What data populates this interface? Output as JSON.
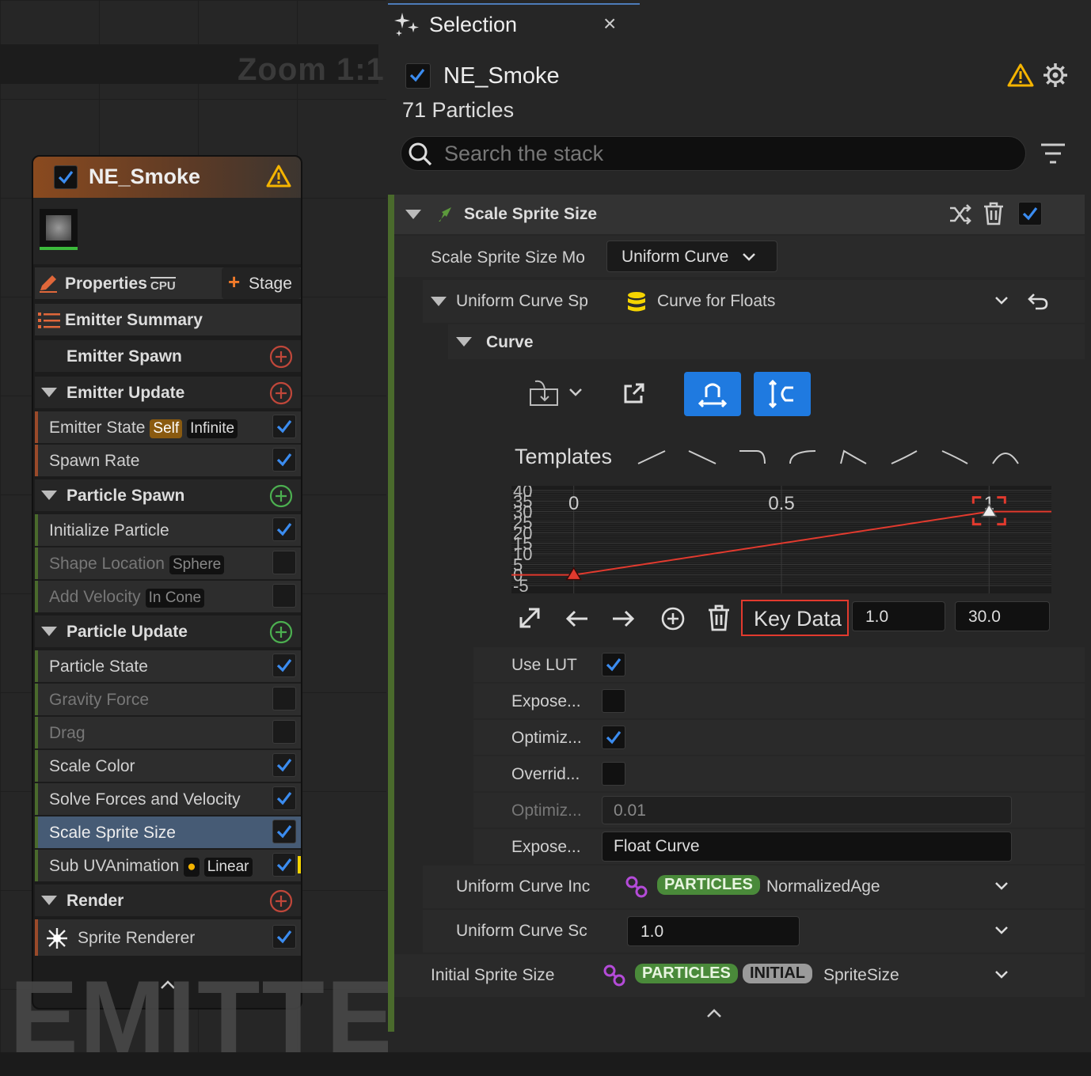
{
  "graph": {
    "zoom_label": "Zoom 1:1",
    "watermark": "EMITTER"
  },
  "node": {
    "title": "NE_Smoke",
    "properties_label": "Properties",
    "cpu_badge": "CPU",
    "stage_label": "Stage",
    "emitter_summary": "Emitter Summary",
    "emitter_spawn": "Emitter Spawn",
    "emitter_update": "Emitter Update",
    "emitter_state": "Emitter State",
    "emitter_state_self": "Self",
    "emitter_state_infinite": "Infinite",
    "spawn_rate": "Spawn Rate",
    "particle_spawn": "Particle Spawn",
    "initialize_particle": "Initialize Particle",
    "shape_location": "Shape Location",
    "shape_location_tag": "Sphere",
    "add_velocity": "Add Velocity",
    "add_velocity_tag": "In Cone",
    "particle_update": "Particle Update",
    "particle_state": "Particle State",
    "gravity_force": "Gravity Force",
    "drag": "Drag",
    "scale_color": "Scale Color",
    "solve_forces": "Solve Forces and Velocity",
    "scale_sprite_size": "Scale Sprite Size",
    "sub_uv": "Sub UVAnimation",
    "sub_uv_tag": "Linear",
    "render": "Render",
    "sprite_renderer": "Sprite Renderer"
  },
  "panel": {
    "tab_title": "Selection",
    "tab_close": "×",
    "emitter_name": "NE_Smoke",
    "particle_count": "71 Particles",
    "search_placeholder": "Search the stack",
    "section_title": "Scale Sprite Size",
    "mode_label": "Scale Sprite Size Mo",
    "mode_value": "Uniform Curve",
    "uniform_curve_label": "Uniform Curve Sp",
    "uniform_curve_value": "Curve for Floats",
    "curve_label": "Curve",
    "templates_label": "Templates",
    "key_data_label": "Key Data",
    "key_time": "1.0",
    "key_value": "30.0",
    "use_lut": "Use LUT",
    "expose1": "Expose...",
    "optimize1": "Optimiz...",
    "override": "Overrid...",
    "optimize2": "Optimiz...",
    "optimize2_value": "0.01",
    "expose2": "Expose...",
    "expose2_value": "Float Curve",
    "curve_index_label": "Uniform Curve Inc",
    "curve_index_tag": "PARTICLES",
    "curve_index_value": "NormalizedAge",
    "curve_scale_label": "Uniform Curve Sc",
    "curve_scale_value": "1.0",
    "initial_size_label": "Initial Sprite Size",
    "initial_tag1": "PARTICLES",
    "initial_tag2": "INITIAL",
    "initial_value": "SpriteSize"
  },
  "chart_data": {
    "type": "line",
    "x_ticks": [
      "0",
      "0.5",
      "1"
    ],
    "y_ticks": [
      "40",
      "35",
      "30",
      "25",
      "20",
      "15",
      "10",
      "5",
      "0",
      "-5"
    ],
    "series": [
      {
        "x": [
          0,
          1
        ],
        "y": [
          0,
          30
        ]
      }
    ],
    "xlim": [
      -0.15,
      1.15
    ],
    "ylim": [
      -5,
      40
    ],
    "line_color": "#e23a2e"
  },
  "colors": {
    "accent_blue": "#1f7ae0",
    "warning": "#f5b400",
    "curve": "#e23a2e",
    "module_green": "#4a6a2c"
  }
}
